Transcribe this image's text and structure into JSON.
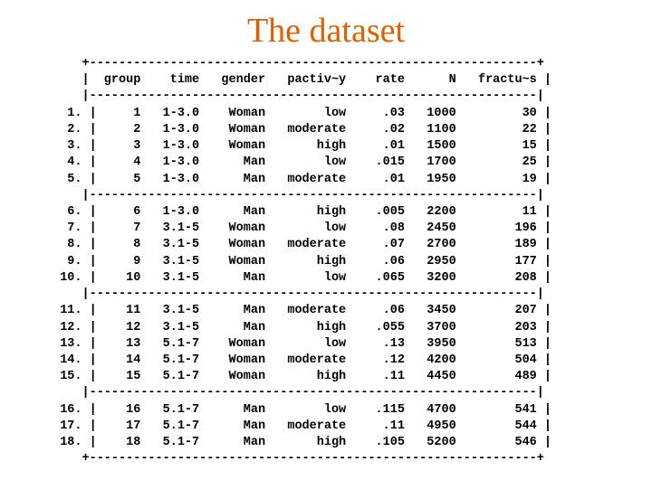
{
  "title": "The dataset",
  "headers": [
    "group",
    "time",
    "gender",
    "pactiv~y",
    "rate",
    "N",
    "fractu~s"
  ],
  "groups": [
    [
      {
        "n": "1.",
        "group": "1",
        "time": "1-3.0",
        "gender": "Woman",
        "pactivy": "low",
        "rate": ".03",
        "N": "1000",
        "fractus": "30"
      },
      {
        "n": "2.",
        "group": "2",
        "time": "1-3.0",
        "gender": "Woman",
        "pactivy": "moderate",
        "rate": ".02",
        "N": "1100",
        "fractus": "22"
      },
      {
        "n": "3.",
        "group": "3",
        "time": "1-3.0",
        "gender": "Woman",
        "pactivy": "high",
        "rate": ".01",
        "N": "1500",
        "fractus": "15"
      },
      {
        "n": "4.",
        "group": "4",
        "time": "1-3.0",
        "gender": "Man",
        "pactivy": "low",
        "rate": ".015",
        "N": "1700",
        "fractus": "25"
      },
      {
        "n": "5.",
        "group": "5",
        "time": "1-3.0",
        "gender": "Man",
        "pactivy": "moderate",
        "rate": ".01",
        "N": "1950",
        "fractus": "19"
      }
    ],
    [
      {
        "n": "6.",
        "group": "6",
        "time": "1-3.0",
        "gender": "Man",
        "pactivy": "high",
        "rate": ".005",
        "N": "2200",
        "fractus": "11"
      },
      {
        "n": "7.",
        "group": "7",
        "time": "3.1-5",
        "gender": "Woman",
        "pactivy": "low",
        "rate": ".08",
        "N": "2450",
        "fractus": "196"
      },
      {
        "n": "8.",
        "group": "8",
        "time": "3.1-5",
        "gender": "Woman",
        "pactivy": "moderate",
        "rate": ".07",
        "N": "2700",
        "fractus": "189"
      },
      {
        "n": "9.",
        "group": "9",
        "time": "3.1-5",
        "gender": "Woman",
        "pactivy": "high",
        "rate": ".06",
        "N": "2950",
        "fractus": "177"
      },
      {
        "n": "10.",
        "group": "10",
        "time": "3.1-5",
        "gender": "Man",
        "pactivy": "low",
        "rate": ".065",
        "N": "3200",
        "fractus": "208"
      }
    ],
    [
      {
        "n": "11.",
        "group": "11",
        "time": "3.1-5",
        "gender": "Man",
        "pactivy": "moderate",
        "rate": ".06",
        "N": "3450",
        "fractus": "207"
      },
      {
        "n": "12.",
        "group": "12",
        "time": "3.1-5",
        "gender": "Man",
        "pactivy": "high",
        "rate": ".055",
        "N": "3700",
        "fractus": "203"
      },
      {
        "n": "13.",
        "group": "13",
        "time": "5.1-7",
        "gender": "Woman",
        "pactivy": "low",
        "rate": ".13",
        "N": "3950",
        "fractus": "513"
      },
      {
        "n": "14.",
        "group": "14",
        "time": "5.1-7",
        "gender": "Woman",
        "pactivy": "moderate",
        "rate": ".12",
        "N": "4200",
        "fractus": "504"
      },
      {
        "n": "15.",
        "group": "15",
        "time": "5.1-7",
        "gender": "Woman",
        "pactivy": "high",
        "rate": ".11",
        "N": "4450",
        "fractus": "489"
      }
    ],
    [
      {
        "n": "16.",
        "group": "16",
        "time": "5.1-7",
        "gender": "Man",
        "pactivy": "low",
        "rate": ".115",
        "N": "4700",
        "fractus": "541"
      },
      {
        "n": "17.",
        "group": "17",
        "time": "5.1-7",
        "gender": "Man",
        "pactivy": "moderate",
        "rate": ".11",
        "N": "4950",
        "fractus": "544"
      },
      {
        "n": "18.",
        "group": "18",
        "time": "5.1-7",
        "gender": "Man",
        "pactivy": "high",
        "rate": ".105",
        "N": "5200",
        "fractus": "546"
      }
    ]
  ]
}
